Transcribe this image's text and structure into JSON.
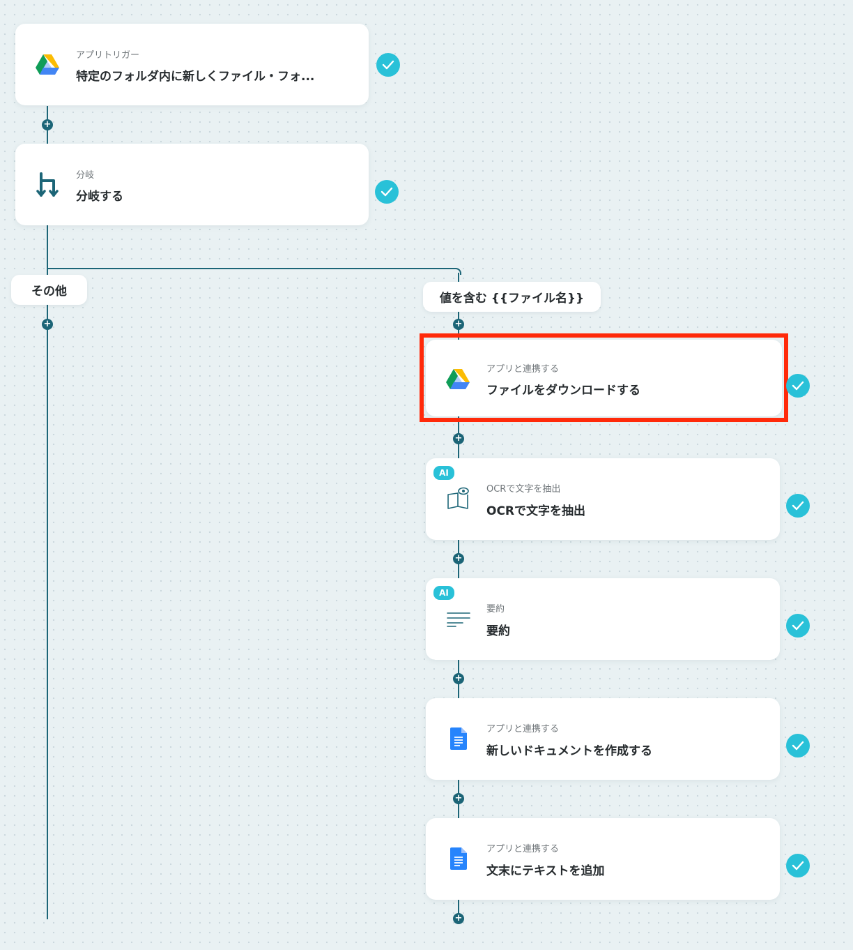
{
  "flow": {
    "steps": [
      {
        "subtitle": "アプリトリガー",
        "title": "特定のフォルダ内に新しくファイル・フォ...",
        "icon": "google-drive-icon",
        "status": "completed"
      },
      {
        "subtitle": "分岐",
        "title": "分岐する",
        "icon": "branch-icon",
        "status": "completed"
      }
    ],
    "branches": {
      "other_label": "その他",
      "condition_label": "値を含む {{ファイル名}}"
    },
    "branch_steps": [
      {
        "subtitle": "アプリと連携する",
        "title": "ファイルをダウンロードする",
        "icon": "google-drive-icon",
        "status": "completed",
        "highlighted": true
      },
      {
        "subtitle": "OCRで文字を抽出",
        "title": "OCRで文字を抽出",
        "icon": "ocr-book-icon",
        "badge": "AI",
        "status": "completed"
      },
      {
        "subtitle": "要約",
        "title": "要約",
        "icon": "summary-lines-icon",
        "badge": "AI",
        "status": "completed"
      },
      {
        "subtitle": "アプリと連携する",
        "title": "新しいドキュメントを作成する",
        "icon": "google-docs-icon",
        "status": "completed"
      },
      {
        "subtitle": "アプリと連携する",
        "title": "文末にテキストを追加",
        "icon": "google-docs-icon",
        "status": "completed"
      }
    ]
  },
  "colors": {
    "connector": "#1c6577",
    "check": "#29c1d8",
    "highlight": "#ff2a0a",
    "background": "#e9f1f3"
  }
}
